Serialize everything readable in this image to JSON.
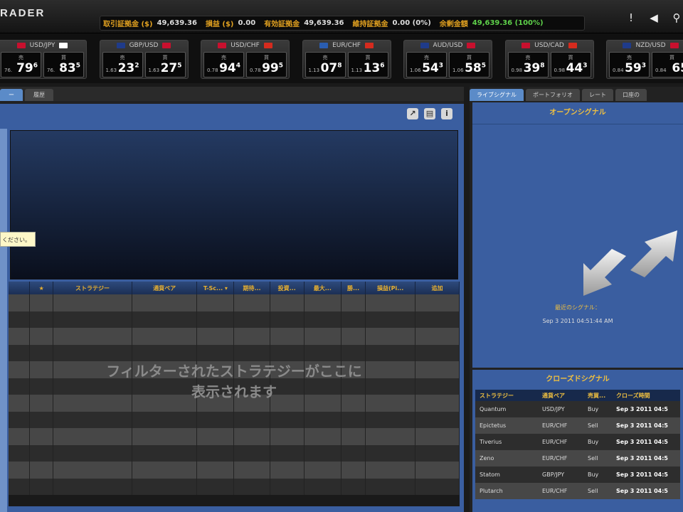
{
  "app": {
    "logo": "RADER"
  },
  "account": [
    {
      "key": "取引証拠金 ($)",
      "value": "49,639.36",
      "green": false
    },
    {
      "key": "損益 ($)",
      "value": "0.00",
      "green": false
    },
    {
      "key": "有効証拠金",
      "value": "49,639.36",
      "green": false
    },
    {
      "key": "維持証拠金",
      "value": "0.00 (0%)",
      "green": false
    },
    {
      "key": "余剰金額",
      "value": "49,639.36 (100%)",
      "green": true
    }
  ],
  "top_icons": [
    "!",
    "◀",
    "⚲"
  ],
  "quotes": [
    {
      "pair": "USD/JPY",
      "f1": "#c8102e",
      "f2": "#ffffff",
      "sell_label": "売",
      "buy_label": "買",
      "sell_pre": "76.",
      "sell_big": "79",
      "sell_sup": "6",
      "buy_pre": "76.",
      "buy_big": "83",
      "buy_sup": "5"
    },
    {
      "pair": "GBP/USD",
      "f1": "#1f3b8a",
      "f2": "#c8102e",
      "sell_label": "売",
      "buy_label": "買",
      "sell_pre": "1.63",
      "sell_big": "23",
      "sell_sup": "2",
      "buy_pre": "1.63",
      "buy_big": "27",
      "buy_sup": "5"
    },
    {
      "pair": "USD/CHF",
      "f1": "#c8102e",
      "f2": "#d52b1e",
      "sell_label": "売",
      "buy_label": "買",
      "sell_pre": "0.78",
      "sell_big": "94",
      "sell_sup": "4",
      "buy_pre": "0.78",
      "buy_big": "99",
      "buy_sup": "5"
    },
    {
      "pair": "EUR/CHF",
      "f1": "#2a5db0",
      "f2": "#d52b1e",
      "sell_label": "売",
      "buy_label": "買",
      "sell_pre": "1.13",
      "sell_big": "07",
      "sell_sup": "8",
      "buy_pre": "1.13",
      "buy_big": "13",
      "buy_sup": "6"
    },
    {
      "pair": "AUD/USD",
      "f1": "#1f3b8a",
      "f2": "#c8102e",
      "sell_label": "売",
      "buy_label": "買",
      "sell_pre": "1.06",
      "sell_big": "54",
      "sell_sup": "3",
      "buy_pre": "1.06",
      "buy_big": "58",
      "buy_sup": "5"
    },
    {
      "pair": "USD/CAD",
      "f1": "#c8102e",
      "f2": "#d52b1e",
      "sell_label": "売",
      "buy_label": "買",
      "sell_pre": "0.98",
      "sell_big": "39",
      "sell_sup": "8",
      "buy_pre": "0.98",
      "buy_big": "44",
      "buy_sup": "3"
    },
    {
      "pair": "NZD/USD",
      "f1": "#1f3b8a",
      "f2": "#c8102e",
      "sell_label": "売",
      "buy_label": "買",
      "sell_pre": "0.84",
      "sell_big": "59",
      "sell_sup": "3",
      "buy_pre": "0.84",
      "buy_big": "65",
      "buy_sup": ""
    }
  ],
  "left": {
    "tabs": [
      "ー",
      "履歴"
    ],
    "tool_icons": [
      "↗",
      "▤",
      "i"
    ],
    "tooltip": "ください。",
    "columns": [
      "",
      "★",
      "ストラテジー",
      "通貨ペア",
      "T-Sc... ▾",
      "期待...",
      "投資...",
      "最大...",
      "勝...",
      "損益(Pi...",
      "追加"
    ],
    "empty_msg_line1": "フィルターされたストラテジーがここに",
    "empty_msg_line2": "表示されます"
  },
  "right": {
    "tabs": [
      "ライブシグナル",
      "ポートフォリオ",
      "レート",
      "口座の"
    ],
    "open_title": "オープンシグナル",
    "last_signal_label": "最近のシグナル：",
    "last_signal_time": "Sep 3 2011 04:51:44 AM",
    "close_title": "クローズドシグナル",
    "close_columns": [
      "ストラテジー",
      "通貨ペア",
      "売買...",
      "クローズ時間"
    ],
    "close_rows": [
      [
        "Quantum",
        "USD/JPY",
        "Buy",
        "Sep 3 2011 04:5"
      ],
      [
        "Epictetus",
        "EUR/CHF",
        "Sell",
        "Sep 3 2011 04:5"
      ],
      [
        "Tiverius",
        "EUR/CHF",
        "Buy",
        "Sep 3 2011 04:5"
      ],
      [
        "Zeno",
        "EUR/CHF",
        "Sell",
        "Sep 3 2011 04:5"
      ],
      [
        "Statom",
        "GBP/JPY",
        "Buy",
        "Sep 3 2011 04:5"
      ],
      [
        "Plutarch",
        "EUR/CHF",
        "Sell",
        "Sep 3 2011 04:5"
      ]
    ]
  }
}
